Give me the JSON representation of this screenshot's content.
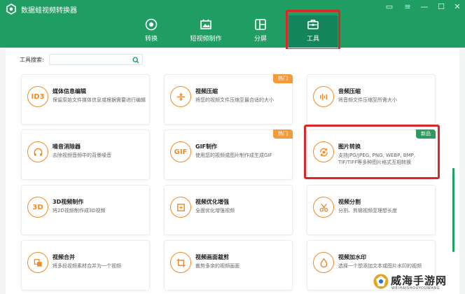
{
  "app": {
    "title": "数据蛙视频转换器"
  },
  "colors": {
    "brand": "#1f9d63",
    "accent": "#f08a24",
    "hot": "#f39a3a",
    "new": "#2f9a5f",
    "highlight": "#d62a2a"
  },
  "nav": {
    "tabs": [
      {
        "label": "转换",
        "icon": "convert-icon"
      },
      {
        "label": "短视频制作",
        "icon": "video-maker-icon"
      },
      {
        "label": "分屏",
        "icon": "split-screen-icon"
      },
      {
        "label": "工具",
        "icon": "toolbox-icon",
        "active": true
      }
    ]
  },
  "search": {
    "label": "工具搜索:",
    "value": "",
    "icon": "search-icon"
  },
  "tools": [
    {
      "title": "媒体信息编辑",
      "desc": "保留原始文件媒体信息或根据需要进行编辑",
      "icon_text": "ID3",
      "icon": "id3-icon"
    },
    {
      "title": "视频压缩",
      "desc": "将您的视频文件压缩至最合适的大小",
      "badge": "热门",
      "icon": "compress-icon"
    },
    {
      "title": "音频压缩",
      "desc": "将音频文件压缩至所需大小",
      "icon": "audio-compress-icon"
    },
    {
      "title": "噪音消除器",
      "desc": "去除视频音频中的背景噪音",
      "icon": "headphones-icon"
    },
    {
      "title": "GIF制作",
      "desc": "使用您的视频或图片制作成生成GIF",
      "badge": "热门",
      "icon_text": "GIF",
      "icon": "gif-icon"
    },
    {
      "title": "图片转换",
      "desc": "支持JPG/JPEG, PNG, WEBP, BMP, TIF/TIFF等多种图片格式互相转换",
      "badge": "新品",
      "icon": "image-convert-icon"
    },
    {
      "title": "3D视频制作",
      "desc": "将2D视频制作成3D视频",
      "icon_text": "3D",
      "icon": "3d-icon"
    },
    {
      "title": "视频优化增强",
      "desc": "全面优化增强视频",
      "icon": "enhance-icon"
    },
    {
      "title": "视频分割",
      "desc": "分割、剪辑视频至理想长度",
      "icon": "scissors-icon"
    },
    {
      "title": "视频合并",
      "desc": "将多段视频素材合并为一个视频",
      "icon": "merge-icon"
    },
    {
      "title": "视频画面裁剪",
      "desc": "裁剪多余的视频画面",
      "icon": "crop-icon"
    },
    {
      "title": "视频加水印",
      "desc": "选择一个想添加文本或图片水印的视频",
      "icon": "watermark-drop-icon"
    }
  ],
  "watermark": {
    "text": "威海手游网",
    "sub": "WEIHAISHOUYOUWANG"
  }
}
